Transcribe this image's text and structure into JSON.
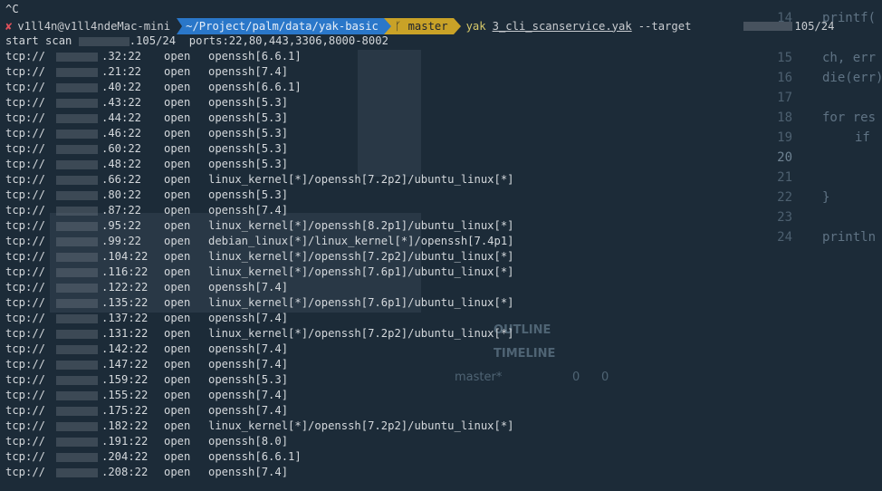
{
  "terminal": {
    "interrupt_line": "^C",
    "prompt": {
      "status_icon": "x-icon",
      "user_host": "v1ll4n@v1ll4ndeMac-mini",
      "path": "~/Project/palm/data/yak-basic",
      "branch_icon": "git-branch-icon",
      "branch": "master",
      "command": "yak",
      "script": "3_cli_scanservice.yak",
      "flag": "--target",
      "target_tail": "105/24"
    },
    "scan_header": {
      "prefix": "start scan",
      "target_tail": ".105/24",
      "ports": "ports:22,80,443,3306,8000-8002"
    },
    "results": [
      {
        "proto": "tcp://",
        "addr": ".32:22",
        "state": "open",
        "service": "openssh[6.6.1]"
      },
      {
        "proto": "tcp://",
        "addr": ".21:22",
        "state": "open",
        "service": "openssh[7.4]"
      },
      {
        "proto": "tcp://",
        "addr": ".40:22",
        "state": "open",
        "service": "openssh[6.6.1]"
      },
      {
        "proto": "tcp://",
        "addr": ".43:22",
        "state": "open",
        "service": "openssh[5.3]"
      },
      {
        "proto": "tcp://",
        "addr": ".44:22",
        "state": "open",
        "service": "openssh[5.3]"
      },
      {
        "proto": "tcp://",
        "addr": ".46:22",
        "state": "open",
        "service": "openssh[5.3]"
      },
      {
        "proto": "tcp://",
        "addr": ".60:22",
        "state": "open",
        "service": "openssh[5.3]"
      },
      {
        "proto": "tcp://",
        "addr": ".48:22",
        "state": "open",
        "service": "openssh[5.3]"
      },
      {
        "proto": "tcp://",
        "addr": ".66:22",
        "state": "open",
        "service": "linux_kernel[*]/openssh[7.2p2]/ubuntu_linux[*]"
      },
      {
        "proto": "tcp://",
        "addr": ".80:22",
        "state": "open",
        "service": "openssh[5.3]"
      },
      {
        "proto": "tcp://",
        "addr": ".87:22",
        "state": "open",
        "service": "openssh[7.4]"
      },
      {
        "proto": "tcp://",
        "addr": ".95:22",
        "state": "open",
        "service": "linux_kernel[*]/openssh[8.2p1]/ubuntu_linux[*]"
      },
      {
        "proto": "tcp://",
        "addr": ".99:22",
        "state": "open",
        "service": "debian_linux[*]/linux_kernel[*]/openssh[7.4p1]"
      },
      {
        "proto": "tcp://",
        "addr": ".104:22",
        "state": "open",
        "service": "linux_kernel[*]/openssh[7.2p2]/ubuntu_linux[*]"
      },
      {
        "proto": "tcp://",
        "addr": ".116:22",
        "state": "open",
        "service": "linux_kernel[*]/openssh[7.6p1]/ubuntu_linux[*]"
      },
      {
        "proto": "tcp://",
        "addr": ".122:22",
        "state": "open",
        "service": "openssh[7.4]"
      },
      {
        "proto": "tcp://",
        "addr": ".135:22",
        "state": "open",
        "service": "linux_kernel[*]/openssh[7.6p1]/ubuntu_linux[*]"
      },
      {
        "proto": "tcp://",
        "addr": ".137:22",
        "state": "open",
        "service": "openssh[7.4]"
      },
      {
        "proto": "tcp://",
        "addr": ".131:22",
        "state": "open",
        "service": "linux_kernel[*]/openssh[7.2p2]/ubuntu_linux[*]"
      },
      {
        "proto": "tcp://",
        "addr": ".142:22",
        "state": "open",
        "service": "openssh[7.4]"
      },
      {
        "proto": "tcp://",
        "addr": ".147:22",
        "state": "open",
        "service": "openssh[7.4]"
      },
      {
        "proto": "tcp://",
        "addr": ".159:22",
        "state": "open",
        "service": "openssh[5.3]"
      },
      {
        "proto": "tcp://",
        "addr": ".155:22",
        "state": "open",
        "service": "openssh[7.4]"
      },
      {
        "proto": "tcp://",
        "addr": ".175:22",
        "state": "open",
        "service": "openssh[7.4]"
      },
      {
        "proto": "tcp://",
        "addr": ".182:22",
        "state": "open",
        "service": "linux_kernel[*]/openssh[7.2p2]/ubuntu_linux[*]"
      },
      {
        "proto": "tcp://",
        "addr": ".191:22",
        "state": "open",
        "service": "openssh[8.0]"
      },
      {
        "proto": "tcp://",
        "addr": ".204:22",
        "state": "open",
        "service": "openssh[6.6.1]"
      },
      {
        "proto": "tcp://",
        "addr": ".208:22",
        "state": "open",
        "service": "openssh[7.4]"
      }
    ]
  },
  "background_editor": {
    "line_numbers": [
      "14",
      "15",
      "16",
      "17",
      "18",
      "19",
      "20",
      "21",
      "22",
      "23",
      "24"
    ],
    "code": [
      "printf(",
      "ch, err",
      "die(err)",
      "for res",
      "if",
      "}",
      "println"
    ],
    "panel_items": {
      "outline": "OUTLINE",
      "timeline": "TIMELINE",
      "branch": "master*",
      "problems": "0",
      "warnings": "0"
    }
  },
  "colors": {
    "background": "#1c2b38",
    "path_segment": "#2a77c9",
    "branch_segment": "#c9a227",
    "error_mark": "#e0505a",
    "command": "#d7c96a"
  }
}
